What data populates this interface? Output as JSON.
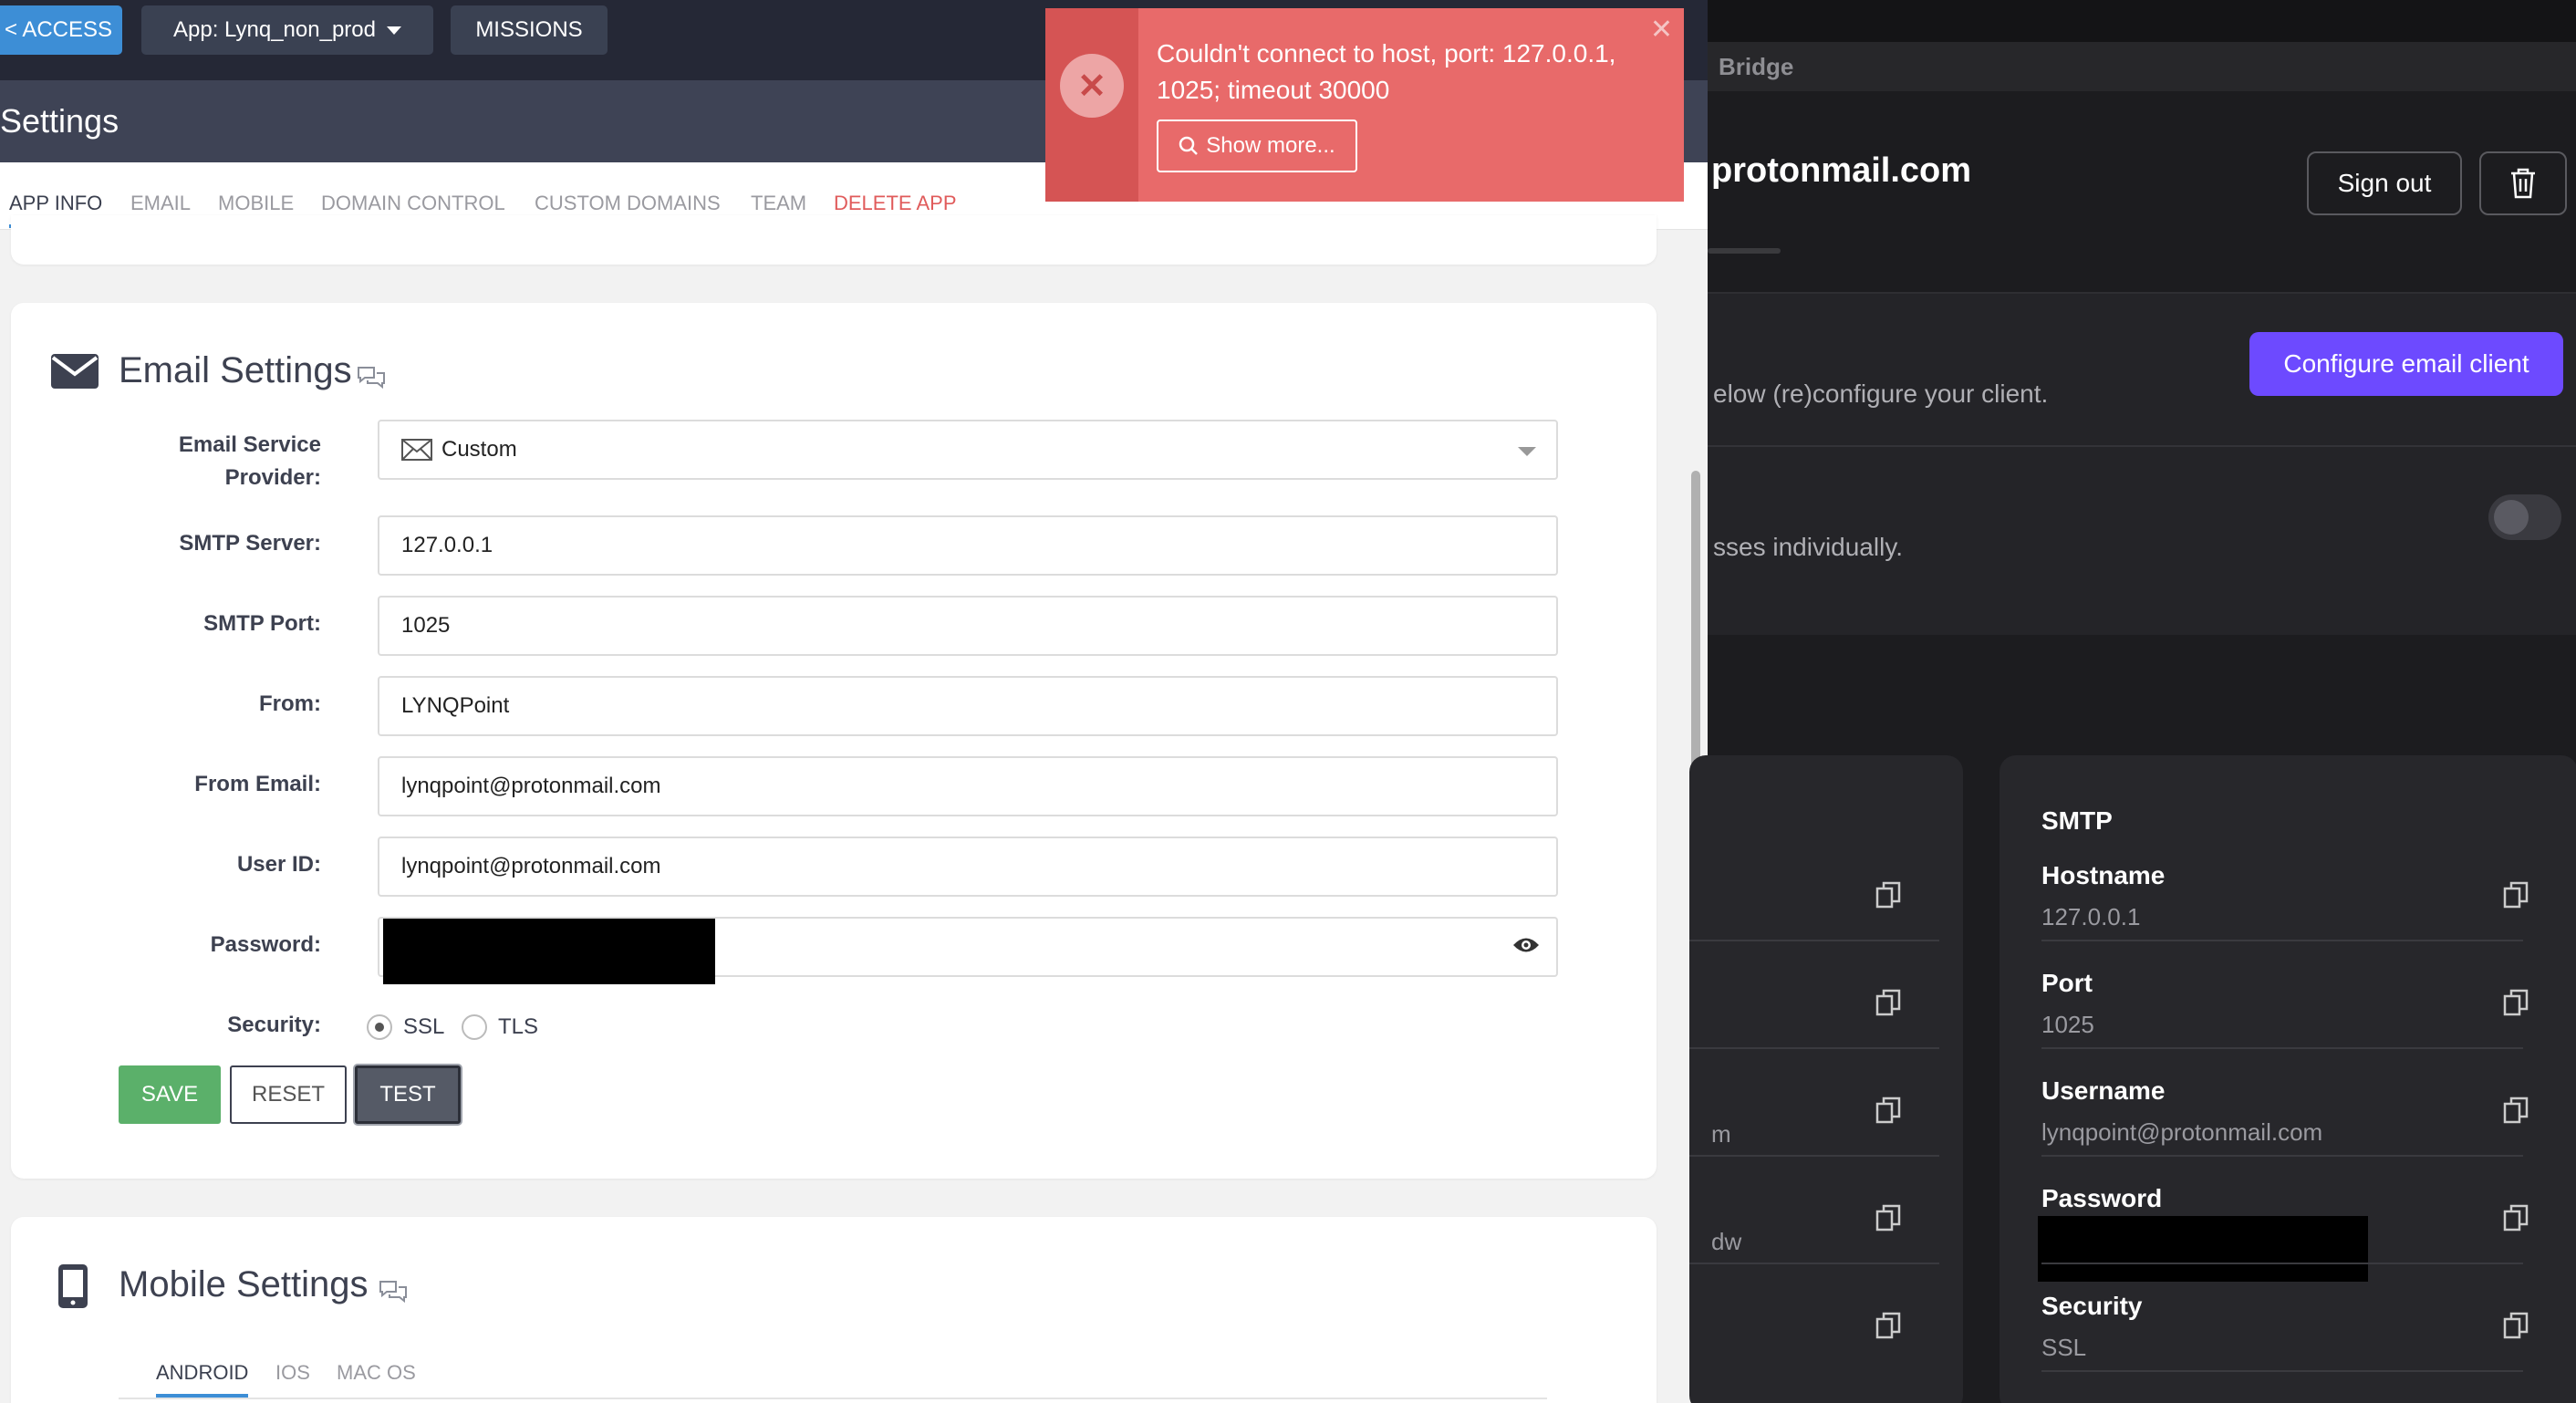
{
  "topbar": {
    "access_label": "< ACCESS",
    "app_label": "App: Lynq_non_prod",
    "missions_label": "MISSIONS"
  },
  "settings": {
    "title": "Settings",
    "tabs": [
      {
        "label": "APP INFO",
        "active": true
      },
      {
        "label": "EMAIL"
      },
      {
        "label": "MOBILE"
      },
      {
        "label": "DOMAIN CONTROL"
      },
      {
        "label": "CUSTOM DOMAINS"
      },
      {
        "label": "TEAM"
      },
      {
        "label": "DELETE APP",
        "danger": true
      }
    ]
  },
  "email_settings": {
    "title": "Email Settings",
    "provider_label": "Email Service Provider:",
    "provider_value": "Custom",
    "smtp_server_label": "SMTP Server:",
    "smtp_server_value": "127.0.0.1",
    "smtp_port_label": "SMTP Port:",
    "smtp_port_value": "1025",
    "from_label": "From:",
    "from_value": "LYNQPoint",
    "from_email_label": "From Email:",
    "from_email_value": "lynqpoint@protonmail.com",
    "user_id_label": "User ID:",
    "user_id_value": "lynqpoint@protonmail.com",
    "password_label": "Password:",
    "security_label": "Security:",
    "security_options": [
      "SSL",
      "TLS"
    ],
    "security_selected": "SSL",
    "save_label": "SAVE",
    "reset_label": "RESET",
    "test_label": "TEST"
  },
  "mobile_settings": {
    "title": "Mobile Settings",
    "tabs": [
      {
        "label": "ANDROID",
        "active": true
      },
      {
        "label": "IOS"
      },
      {
        "label": "MAC OS"
      }
    ]
  },
  "toast": {
    "message": "Couldn't connect to host, port: 127.0.0.1, 1025; timeout 30000",
    "show_more_label": "Show more..."
  },
  "bridge": {
    "app_title": "Bridge",
    "account": "protonmail.com",
    "sign_out_label": "Sign out",
    "configure_label": "Configure email client",
    "configure_text": "elow (re)configure your client.",
    "addresses_text": "sses individually.",
    "left_fragments": [
      "m",
      "dw"
    ],
    "smtp": {
      "title": "SMTP",
      "hostname_label": "Hostname",
      "hostname_value": "127.0.0.1",
      "port_label": "Port",
      "port_value": "1025",
      "username_label": "Username",
      "username_value": "lynqpoint@protonmail.com",
      "password_label": "Password",
      "security_label": "Security",
      "security_value": "SSL"
    }
  },
  "colors": {
    "accent_blue": "#3d8ed6",
    "danger": "#e05b5b",
    "save_green": "#5bb06a",
    "toast_red": "#e86a6a",
    "bridge_purple": "#6d4aff"
  }
}
